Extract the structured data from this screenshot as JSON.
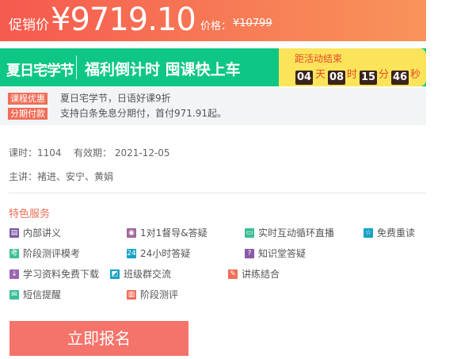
{
  "price": {
    "label": "促销价",
    "value": "¥9719.10",
    "orig_label": "价格：",
    "orig_value": "¥10799"
  },
  "promo": {
    "tag": "夏日宅学节",
    "slogan": "福利倒计时 囤课快上车",
    "countdown_label": "距活动结束",
    "days": "04",
    "days_unit": "天",
    "hours": "08",
    "hours_unit": "时",
    "minutes": "15",
    "minutes_unit": "分",
    "seconds": "46",
    "seconds_unit": "秒",
    "colors": {
      "green": "#0fc784",
      "yellow": "#fbe45a",
      "accent": "#e84a2a"
    }
  },
  "offers": [
    {
      "tag": "课程优惠",
      "text": "夏日宅学节，日语好课9折"
    },
    {
      "tag": "分期付款",
      "text": "支持白条免息分期付，首付971.91起。"
    }
  ],
  "info": {
    "hours": "课时：1104",
    "validity": "有效期： 2021-12-05",
    "lecturers": "主讲：褚进、安宁、黄娟"
  },
  "features": {
    "title": "特色服务",
    "items": [
      {
        "label": "内部讲义",
        "icon": "book-icon",
        "color": "#7b5aa6",
        "glyph": "▤"
      },
      {
        "label": "1对1督导&答疑",
        "icon": "person-icon",
        "color": "#a0679b",
        "glyph": "◉"
      },
      {
        "label": "实时互动循环直播",
        "icon": "monitor-icon",
        "color": "#3cbf97",
        "glyph": "▭"
      },
      {
        "label": "免费重读",
        "icon": "star-icon",
        "color": "#17a3c6",
        "glyph": "☆"
      },
      {
        "label": "阶段测评模考",
        "icon": "exam-icon",
        "color": "#3cbf97",
        "glyph": "考"
      },
      {
        "label": "24小时答疑",
        "icon": "clock-24-icon",
        "color": "#17a3c6",
        "glyph": "24"
      },
      {
        "label": "知识堂答疑",
        "icon": "question-icon",
        "color": "#8a5aa8",
        "glyph": "?"
      },
      {
        "label": "学习资料免费下载",
        "icon": "download-icon",
        "color": "#9a64b4",
        "glyph": "↓"
      },
      {
        "label": "班级群交流",
        "icon": "chat-icon",
        "color": "#17a3c6",
        "glyph": "◩"
      },
      {
        "label": "讲练结合",
        "icon": "edit-icon",
        "color": "#f16e57",
        "glyph": "✎"
      },
      {
        "label": "短信提醒",
        "icon": "message-icon",
        "color": "#3cbf97",
        "glyph": "✉"
      },
      {
        "label": "阶段测评",
        "icon": "chart-icon",
        "color": "#f16e57",
        "glyph": "▥"
      }
    ]
  },
  "enroll_button": "立即报名"
}
